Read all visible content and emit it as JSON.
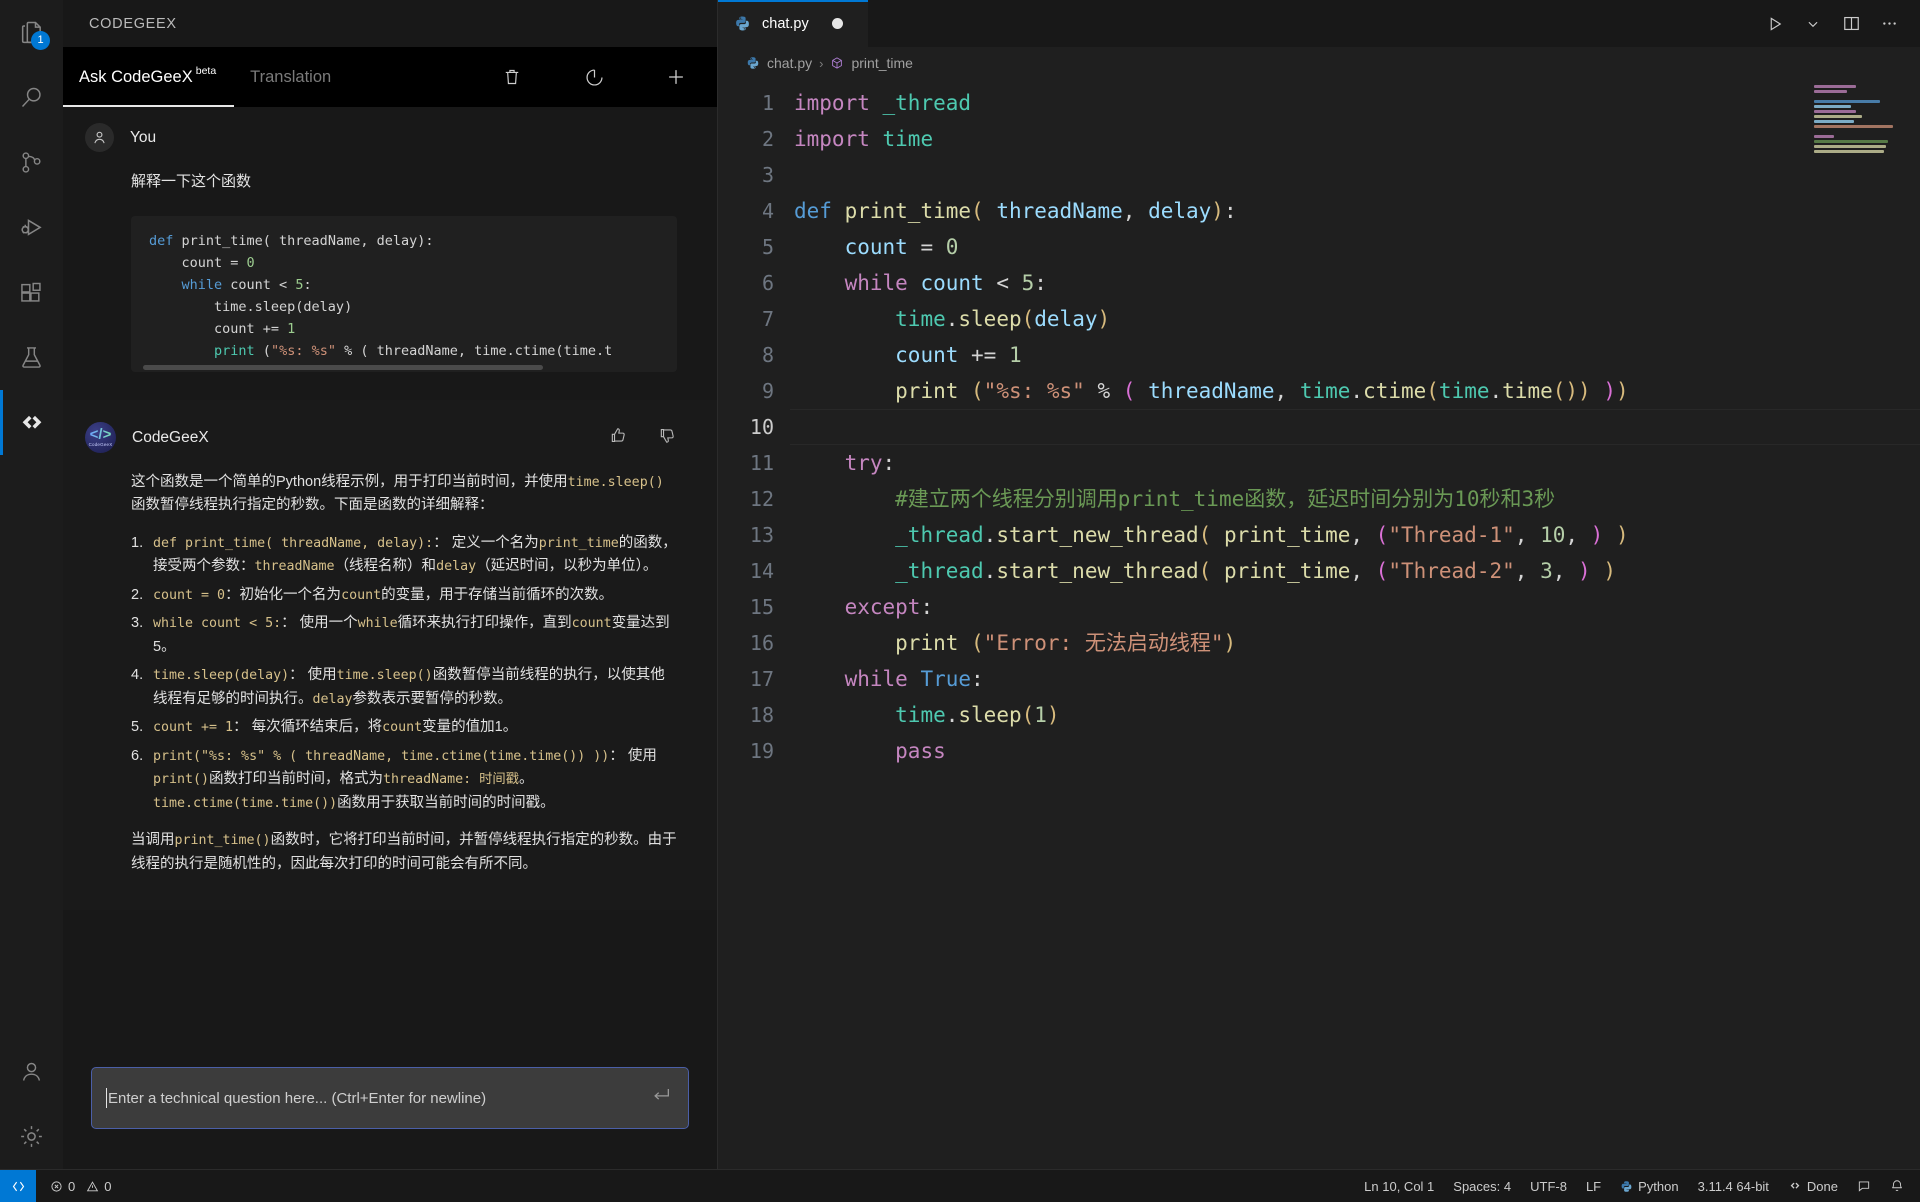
{
  "activitybar": {
    "items": [
      {
        "name": "explorer",
        "icon": "files-icon",
        "badge": "1",
        "active": false
      },
      {
        "name": "search",
        "icon": "search-icon",
        "badge": "",
        "active": false
      },
      {
        "name": "source-control",
        "icon": "source-control-icon",
        "badge": "",
        "active": false
      },
      {
        "name": "run-and-debug",
        "icon": "run-debug-icon",
        "badge": "",
        "active": false
      },
      {
        "name": "extensions",
        "icon": "extensions-icon",
        "badge": "",
        "active": false
      },
      {
        "name": "testing",
        "icon": "beaker-icon",
        "badge": "",
        "active": false
      },
      {
        "name": "codegeex",
        "icon": "codegeex-icon",
        "badge": "",
        "active": true
      }
    ],
    "bottom": [
      {
        "name": "accounts",
        "icon": "account-icon"
      },
      {
        "name": "manage",
        "icon": "gear-icon"
      }
    ]
  },
  "sidebar": {
    "title": "CODEGEEX",
    "tabs": [
      {
        "label": "Ask CodeGeeX",
        "sup": "beta",
        "active": true
      },
      {
        "label": "Translation",
        "sup": "",
        "active": false
      }
    ],
    "tools": [
      {
        "name": "clear-chat-button",
        "icon": "trash-icon"
      },
      {
        "name": "history-button",
        "icon": "history-icon"
      },
      {
        "name": "new-chat-button",
        "icon": "plus-icon"
      }
    ]
  },
  "chat": {
    "user": {
      "name": "You",
      "text": "解释一下这个函数",
      "code_lines": [
        [
          {
            "t": "def ",
            "c": "kw"
          },
          {
            "t": "print_time( threadName, delay):",
            "c": ""
          }
        ],
        [
          {
            "t": "    count = ",
            "c": ""
          },
          {
            "t": "0",
            "c": "num"
          }
        ],
        [
          {
            "t": "    ",
            "c": ""
          },
          {
            "t": "while",
            "c": "kw"
          },
          {
            "t": " count < ",
            "c": ""
          },
          {
            "t": "5",
            "c": "num"
          },
          {
            "t": ":",
            "c": ""
          }
        ],
        [
          {
            "t": "        time.sleep(delay)",
            "c": ""
          }
        ],
        [
          {
            "t": "        count += ",
            "c": ""
          },
          {
            "t": "1",
            "c": "num"
          }
        ],
        [
          {
            "t": "        ",
            "c": ""
          },
          {
            "t": "print",
            "c": "fn"
          },
          {
            "t": " (",
            "c": ""
          },
          {
            "t": "\"%s: %s\"",
            "c": "str"
          },
          {
            "t": " % ( threadName, time.ctime(time.t",
            "c": ""
          }
        ]
      ]
    },
    "bot": {
      "name": "CodeGeeX",
      "avatar_glyph": "</>",
      "avatar_sub": "CodeGeeX",
      "intro_p1_a": "这个函数是一个简单的Python线程示例，用于打印当前时间，并使用",
      "intro_code": "time.sleep()",
      "intro_p1_b": "函数暂停线程执行指定的秒数。下面是函数的详细解释：",
      "items": [
        {
          "code": "def print_time( threadName, delay):",
          "text_a": "： 定义一个名为",
          "code2": "print_time",
          "text_b": "的函数，接受两个参数：",
          "code3": "threadName",
          "text_c": "（线程名称）和",
          "code4": "delay",
          "text_d": "（延迟时间，以秒为单位）。"
        },
        {
          "code": "count = 0",
          "text_a": "：初始化一个名为",
          "code2": "count",
          "text_b": "的变量，用于存储当前循环的次数。",
          "code3": "",
          "text_c": "",
          "code4": "",
          "text_d": ""
        },
        {
          "code": "while count < 5:",
          "text_a": "： 使用一个",
          "code2": "while",
          "text_b": "循环来执行打印操作，直到",
          "code3": "count",
          "text_c": "变量达到5。",
          "code4": "",
          "text_d": ""
        },
        {
          "code": "time.sleep(delay)",
          "text_a": "： 使用",
          "code2": "time.sleep()",
          "text_b": "函数暂停当前线程的执行，以使其他线程有足够的时间执行。",
          "code3": "delay",
          "text_c": "参数表示要暂停的秒数。",
          "code4": "",
          "text_d": ""
        },
        {
          "code": "count += 1",
          "text_a": "： 每次循环结束后，将",
          "code2": "count",
          "text_b": "变量的值加1。",
          "code3": "",
          "text_c": "",
          "code4": "",
          "text_d": ""
        },
        {
          "code": "print(\"%s: %s\" % ( threadName, time.ctime(time.time()) ))",
          "text_a": "： 使用",
          "code2": "print()",
          "text_b": "函数打印当前时间，格式为",
          "code3": "threadName: 时间戳",
          "text_c": "。",
          "code4": "time.ctime(time.time())",
          "text_d": "函数用于获取当前时间的时间戳。"
        }
      ],
      "outro_a": "当调用",
      "outro_code": "print_time()",
      "outro_b": "函数时，它将打印当前时间，并暂停线程执行指定的秒数。由于线程的执行是随机性的，因此每次打印的时间可能会有所不同。",
      "feedback": [
        {
          "name": "thumbs-up-button",
          "icon": "thumbs-up-icon"
        },
        {
          "name": "thumbs-down-button",
          "icon": "thumbs-down-icon"
        }
      ]
    }
  },
  "composer": {
    "placeholder": "Enter a technical question here... (Ctrl+Enter for newline)",
    "submit_icon": "enter-return-icon"
  },
  "editor": {
    "tab": {
      "label": "chat.py",
      "icon": "python-icon",
      "dirty": true
    },
    "tab_actions": [
      {
        "name": "run-python-file-button",
        "icon": "play-icon"
      },
      {
        "name": "run-dropdown-button",
        "icon": "chevron-down-icon"
      },
      {
        "name": "split-editor-button",
        "icon": "split-icon"
      },
      {
        "name": "more-actions-button",
        "icon": "ellipsis-icon"
      }
    ],
    "breadcrumb": [
      {
        "label": "chat.py",
        "icon": "python-icon"
      },
      {
        "label": "print_time",
        "icon": "symbol-method-icon"
      }
    ],
    "current_line": 10,
    "lines": [
      {
        "n": 1,
        "tokens": [
          {
            "t": "import",
            "c": "ek"
          },
          {
            "t": " ",
            "c": "ewhite"
          },
          {
            "t": "_thread",
            "c": "egreen"
          }
        ]
      },
      {
        "n": 2,
        "tokens": [
          {
            "t": "import",
            "c": "ek"
          },
          {
            "t": " ",
            "c": "ewhite"
          },
          {
            "t": "time",
            "c": "egreen"
          }
        ]
      },
      {
        "n": 3,
        "tokens": []
      },
      {
        "n": 4,
        "tokens": [
          {
            "t": "def",
            "c": "eblue"
          },
          {
            "t": " ",
            "c": "ewhite"
          },
          {
            "t": "print_time",
            "c": "eyellow"
          },
          {
            "t": "(",
            "c": "epar"
          },
          {
            "t": " ",
            "c": "ewhite"
          },
          {
            "t": "threadName",
            "c": "evar"
          },
          {
            "t": ", ",
            "c": "ewhite"
          },
          {
            "t": "delay",
            "c": "evar"
          },
          {
            "t": ")",
            "c": "epar"
          },
          {
            "t": ":",
            "c": "ewhite"
          }
        ]
      },
      {
        "n": 5,
        "tokens": [
          {
            "t": "    ",
            "c": "ewhite"
          },
          {
            "t": "count",
            "c": "evar"
          },
          {
            "t": " = ",
            "c": "ewhite"
          },
          {
            "t": "0",
            "c": "enum"
          }
        ]
      },
      {
        "n": 6,
        "tokens": [
          {
            "t": "    ",
            "c": "ewhite"
          },
          {
            "t": "while",
            "c": "ek"
          },
          {
            "t": " ",
            "c": "ewhite"
          },
          {
            "t": "count",
            "c": "evar"
          },
          {
            "t": " < ",
            "c": "ewhite"
          },
          {
            "t": "5",
            "c": "enum"
          },
          {
            "t": ":",
            "c": "ewhite"
          }
        ]
      },
      {
        "n": 7,
        "tokens": [
          {
            "t": "        ",
            "c": "ewhite"
          },
          {
            "t": "time",
            "c": "egreen"
          },
          {
            "t": ".",
            "c": "ewhite"
          },
          {
            "t": "sleep",
            "c": "eyellow"
          },
          {
            "t": "(",
            "c": "epar"
          },
          {
            "t": "delay",
            "c": "evar"
          },
          {
            "t": ")",
            "c": "epar"
          }
        ]
      },
      {
        "n": 8,
        "tokens": [
          {
            "t": "        ",
            "c": "ewhite"
          },
          {
            "t": "count",
            "c": "evar"
          },
          {
            "t": " += ",
            "c": "ewhite"
          },
          {
            "t": "1",
            "c": "enum"
          }
        ]
      },
      {
        "n": 9,
        "tokens": [
          {
            "t": "        ",
            "c": "ewhite"
          },
          {
            "t": "print",
            "c": "eyellow"
          },
          {
            "t": " (",
            "c": "epar"
          },
          {
            "t": "\"%s: %s\"",
            "c": "estr"
          },
          {
            "t": " % ",
            "c": "ewhite"
          },
          {
            "t": "(",
            "c": "epar2"
          },
          {
            "t": " ",
            "c": "ewhite"
          },
          {
            "t": "threadName",
            "c": "evar"
          },
          {
            "t": ", ",
            "c": "ewhite"
          },
          {
            "t": "time",
            "c": "egreen"
          },
          {
            "t": ".",
            "c": "ewhite"
          },
          {
            "t": "ctime",
            "c": "eyellow"
          },
          {
            "t": "(",
            "c": "epar"
          },
          {
            "t": "time",
            "c": "egreen"
          },
          {
            "t": ".",
            "c": "ewhite"
          },
          {
            "t": "time",
            "c": "eyellow"
          },
          {
            "t": "())",
            "c": "epar"
          },
          {
            "t": " ",
            "c": "ewhite"
          },
          {
            "t": ")",
            "c": "epar2"
          },
          {
            "t": ")",
            "c": "epar"
          }
        ]
      },
      {
        "n": 10,
        "tokens": []
      },
      {
        "n": 11,
        "tokens": [
          {
            "t": "    ",
            "c": "ewhite"
          },
          {
            "t": "try",
            "c": "ek"
          },
          {
            "t": ":",
            "c": "ewhite"
          }
        ]
      },
      {
        "n": 12,
        "tokens": [
          {
            "t": "        ",
            "c": "ewhite"
          },
          {
            "t": "#建立两个线程分别调用print_time函数，延迟时间分别为10秒和3秒",
            "c": "ecmt"
          }
        ]
      },
      {
        "n": 13,
        "tokens": [
          {
            "t": "        ",
            "c": "ewhite"
          },
          {
            "t": "_thread",
            "c": "egreen"
          },
          {
            "t": ".",
            "c": "ewhite"
          },
          {
            "t": "start_new_thread",
            "c": "eyellow"
          },
          {
            "t": "(",
            "c": "epar"
          },
          {
            "t": " ",
            "c": "ewhite"
          },
          {
            "t": "print_time",
            "c": "eyellow"
          },
          {
            "t": ", ",
            "c": "ewhite"
          },
          {
            "t": "(",
            "c": "epar2"
          },
          {
            "t": "\"Thread-1\"",
            "c": "estr"
          },
          {
            "t": ", ",
            "c": "ewhite"
          },
          {
            "t": "10",
            "c": "enum"
          },
          {
            "t": ", ",
            "c": "ewhite"
          },
          {
            "t": ")",
            "c": "epar2"
          },
          {
            "t": " ",
            "c": "ewhite"
          },
          {
            "t": ")",
            "c": "epar"
          }
        ]
      },
      {
        "n": 14,
        "tokens": [
          {
            "t": "        ",
            "c": "ewhite"
          },
          {
            "t": "_thread",
            "c": "egreen"
          },
          {
            "t": ".",
            "c": "ewhite"
          },
          {
            "t": "start_new_thread",
            "c": "eyellow"
          },
          {
            "t": "(",
            "c": "epar"
          },
          {
            "t": " ",
            "c": "ewhite"
          },
          {
            "t": "print_time",
            "c": "eyellow"
          },
          {
            "t": ", ",
            "c": "ewhite"
          },
          {
            "t": "(",
            "c": "epar2"
          },
          {
            "t": "\"Thread-2\"",
            "c": "estr"
          },
          {
            "t": ", ",
            "c": "ewhite"
          },
          {
            "t": "3",
            "c": "enum"
          },
          {
            "t": ", ",
            "c": "ewhite"
          },
          {
            "t": ")",
            "c": "epar2"
          },
          {
            "t": " ",
            "c": "ewhite"
          },
          {
            "t": ")",
            "c": "epar"
          }
        ]
      },
      {
        "n": 15,
        "tokens": [
          {
            "t": "    ",
            "c": "ewhite"
          },
          {
            "t": "except",
            "c": "ek"
          },
          {
            "t": ":",
            "c": "ewhite"
          }
        ]
      },
      {
        "n": 16,
        "tokens": [
          {
            "t": "        ",
            "c": "ewhite"
          },
          {
            "t": "print",
            "c": "eyellow"
          },
          {
            "t": " (",
            "c": "epar"
          },
          {
            "t": "\"Error: 无法启动线程\"",
            "c": "estr"
          },
          {
            "t": ")",
            "c": "epar"
          }
        ]
      },
      {
        "n": 17,
        "tokens": [
          {
            "t": "    ",
            "c": "ewhite"
          },
          {
            "t": "while",
            "c": "ek"
          },
          {
            "t": " ",
            "c": "ewhite"
          },
          {
            "t": "True",
            "c": "eblue"
          },
          {
            "t": ":",
            "c": "ewhite"
          }
        ]
      },
      {
        "n": 18,
        "tokens": [
          {
            "t": "        ",
            "c": "ewhite"
          },
          {
            "t": "time",
            "c": "egreen"
          },
          {
            "t": ".",
            "c": "ewhite"
          },
          {
            "t": "sleep",
            "c": "eyellow"
          },
          {
            "t": "(",
            "c": "epar"
          },
          {
            "t": "1",
            "c": "enum"
          },
          {
            "t": ")",
            "c": "epar"
          }
        ]
      },
      {
        "n": 19,
        "tokens": [
          {
            "t": "        ",
            "c": "ewhite"
          },
          {
            "t": "pass",
            "c": "ek"
          }
        ]
      }
    ]
  },
  "statusbar": {
    "remote_icon": "remote-window-icon",
    "errors": "0",
    "warnings": "0",
    "position": "Ln 10, Col 1",
    "indent": "Spaces: 4",
    "encoding": "UTF-8",
    "eol": "LF",
    "language": "Python",
    "interpreter": "3.11.4 64-bit",
    "codegeex_status": "Done",
    "feedback_icon": "feedback-icon",
    "bell_icon": "bell-icon"
  },
  "colors": {
    "accent": "#0078d4",
    "editor_bg": "#1f1f1f",
    "sidebar_bg": "#181818",
    "comment": "#6a9955",
    "string": "#ce9178",
    "keyword": "#c586c0"
  }
}
